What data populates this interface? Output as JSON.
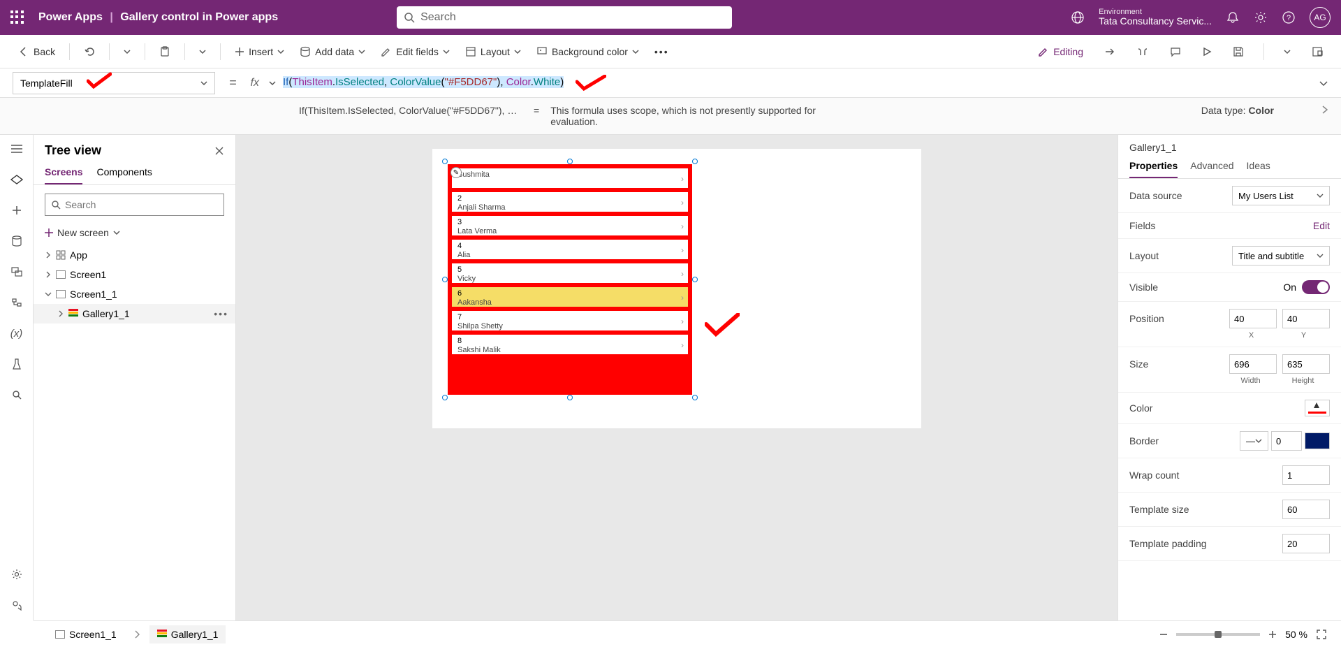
{
  "header": {
    "app": "Power Apps",
    "page": "Gallery control in Power apps",
    "search_placeholder": "Search",
    "env_label": "Environment",
    "env_name": "Tata Consultancy Servic...",
    "avatar": "AG"
  },
  "toolbar": {
    "back": "Back",
    "insert": "Insert",
    "add_data": "Add data",
    "edit_fields": "Edit fields",
    "layout": "Layout",
    "bg_color": "Background color",
    "editing": "Editing"
  },
  "formula": {
    "property": "TemplateFill",
    "tokens": {
      "if": "If",
      "open1": "(",
      "this": "ThisItem",
      "dot1": ".",
      "isSel": "IsSelected",
      "comma1": ", ",
      "cv": "ColorValue",
      "open2": "(",
      "hex": "\"#F5DD67\"",
      "close2": ")",
      "comma2": ", ",
      "color": "Color",
      "dot2": ".",
      "white": "White",
      "close1": ")"
    },
    "help_left": "If(ThisItem.IsSelected, ColorValue(\"#F5DD67\"), Col...",
    "help_eq": "=",
    "help_msg": "This formula uses scope, which is not presently supported for evaluation.",
    "datatype_label": "Data type: ",
    "datatype_value": "Color"
  },
  "tree": {
    "title": "Tree view",
    "tab_screens": "Screens",
    "tab_components": "Components",
    "search_placeholder": "Search",
    "new_screen": "New screen",
    "items": {
      "app": "App",
      "screen1": "Screen1",
      "screen1_1": "Screen1_1",
      "gallery": "Gallery1_1"
    }
  },
  "gallery_rows": [
    {
      "num": "",
      "name": "Sushmita",
      "sel": false
    },
    {
      "num": "2",
      "name": "Anjali Sharma",
      "sel": false
    },
    {
      "num": "3",
      "name": "Lata Verma",
      "sel": false
    },
    {
      "num": "4",
      "name": "Alia",
      "sel": false
    },
    {
      "num": "5",
      "name": "Vicky",
      "sel": false
    },
    {
      "num": "6",
      "name": "Aakansha",
      "sel": true
    },
    {
      "num": "7",
      "name": "Shilpa Shetty",
      "sel": false
    },
    {
      "num": "8",
      "name": "Sakshi Malik",
      "sel": false
    }
  ],
  "footer": {
    "crumb1": "Screen1_1",
    "crumb2": "Gallery1_1",
    "zoom": "50",
    "pct": "%"
  },
  "rpanel": {
    "name": "Gallery1_1",
    "tab_props": "Properties",
    "tab_adv": "Advanced",
    "tab_ideas": "Ideas",
    "data_source_lbl": "Data source",
    "data_source": "My Users List",
    "fields_lbl": "Fields",
    "edit": "Edit",
    "layout_lbl": "Layout",
    "layout": "Title and subtitle",
    "visible_lbl": "Visible",
    "visible_on": "On",
    "position_lbl": "Position",
    "pos_x": "40",
    "pos_y": "40",
    "xl": "X",
    "yl": "Y",
    "size_lbl": "Size",
    "w": "696",
    "h": "635",
    "wl": "Width",
    "hl": "Height",
    "color_lbl": "Color",
    "border_lbl": "Border",
    "border_val": "0",
    "wrap_lbl": "Wrap count",
    "wrap": "1",
    "tsize_lbl": "Template size",
    "tsize": "60",
    "tpad_lbl": "Template padding",
    "tpad": "20"
  }
}
